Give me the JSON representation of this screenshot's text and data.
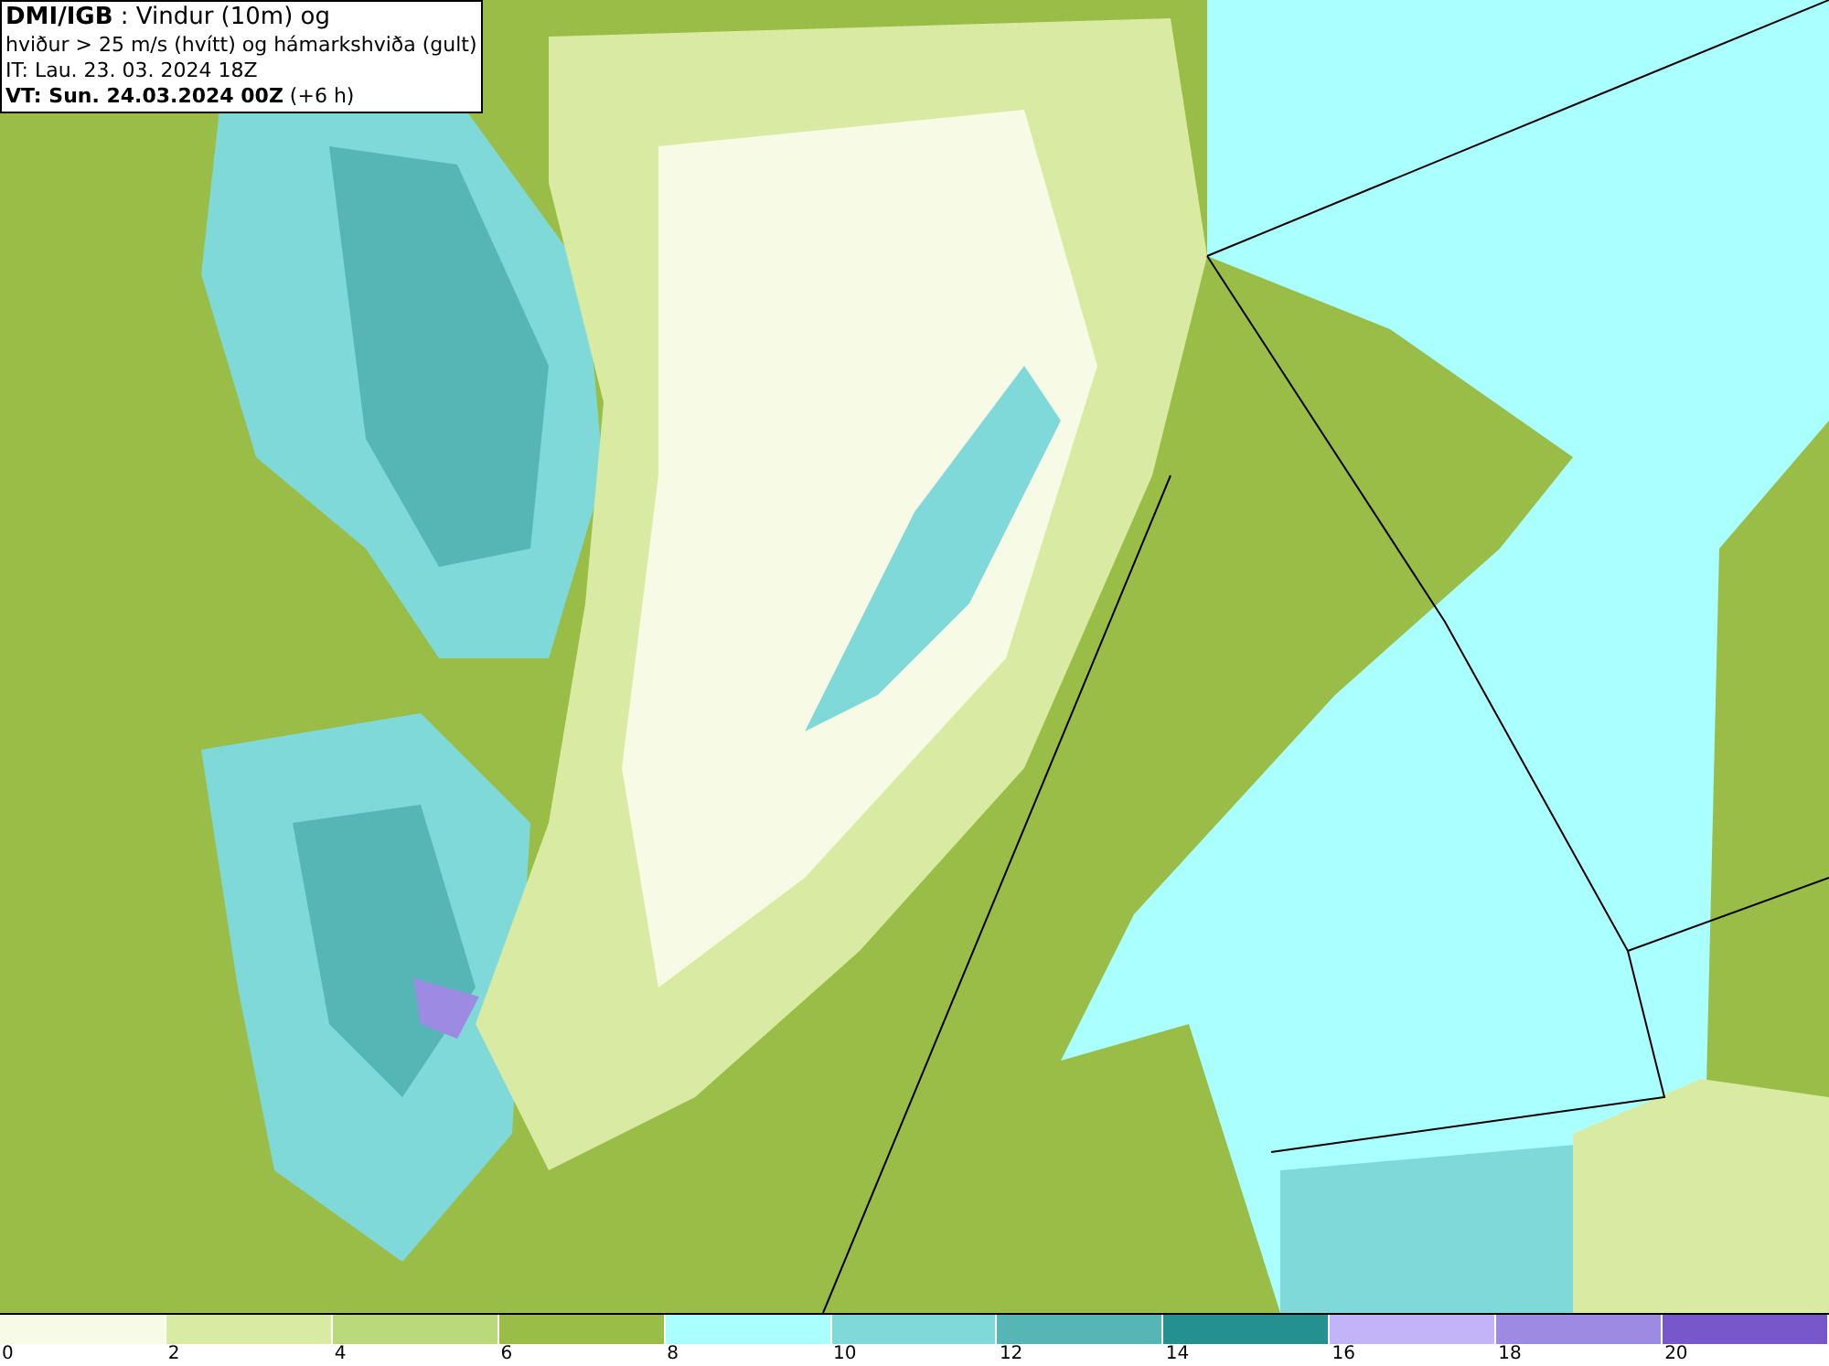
{
  "header": {
    "lines": [
      "**DMI/IGB** : Vindur (10m) og",
      "hviður > 25 m/s (hvítt) og hámarkshviða (gult)",
      "IT: Lau. 23. 03. 2024 18Z",
      "**VT: Sun. 24.03.2024 00Z** (+6 h)"
    ]
  },
  "legend": [
    {
      "label": "0",
      "color": "#f7fbe6"
    },
    {
      "label": "2",
      "color": "#d9eba2"
    },
    {
      "label": "4",
      "color": "#b9d97a"
    },
    {
      "label": "6",
      "color": "#99bd46"
    },
    {
      "label": "8",
      "color": "#aaffff"
    },
    {
      "label": "10",
      "color": "#80d9d9"
    },
    {
      "label": "12",
      "color": "#56b6b6"
    },
    {
      "label": "14",
      "color": "#249090"
    },
    {
      "label": "16",
      "color": "#c3b3f7"
    },
    {
      "label": "18",
      "color": "#9d8ae2"
    },
    {
      "label": "20",
      "color": "#7857ca"
    }
  ]
}
